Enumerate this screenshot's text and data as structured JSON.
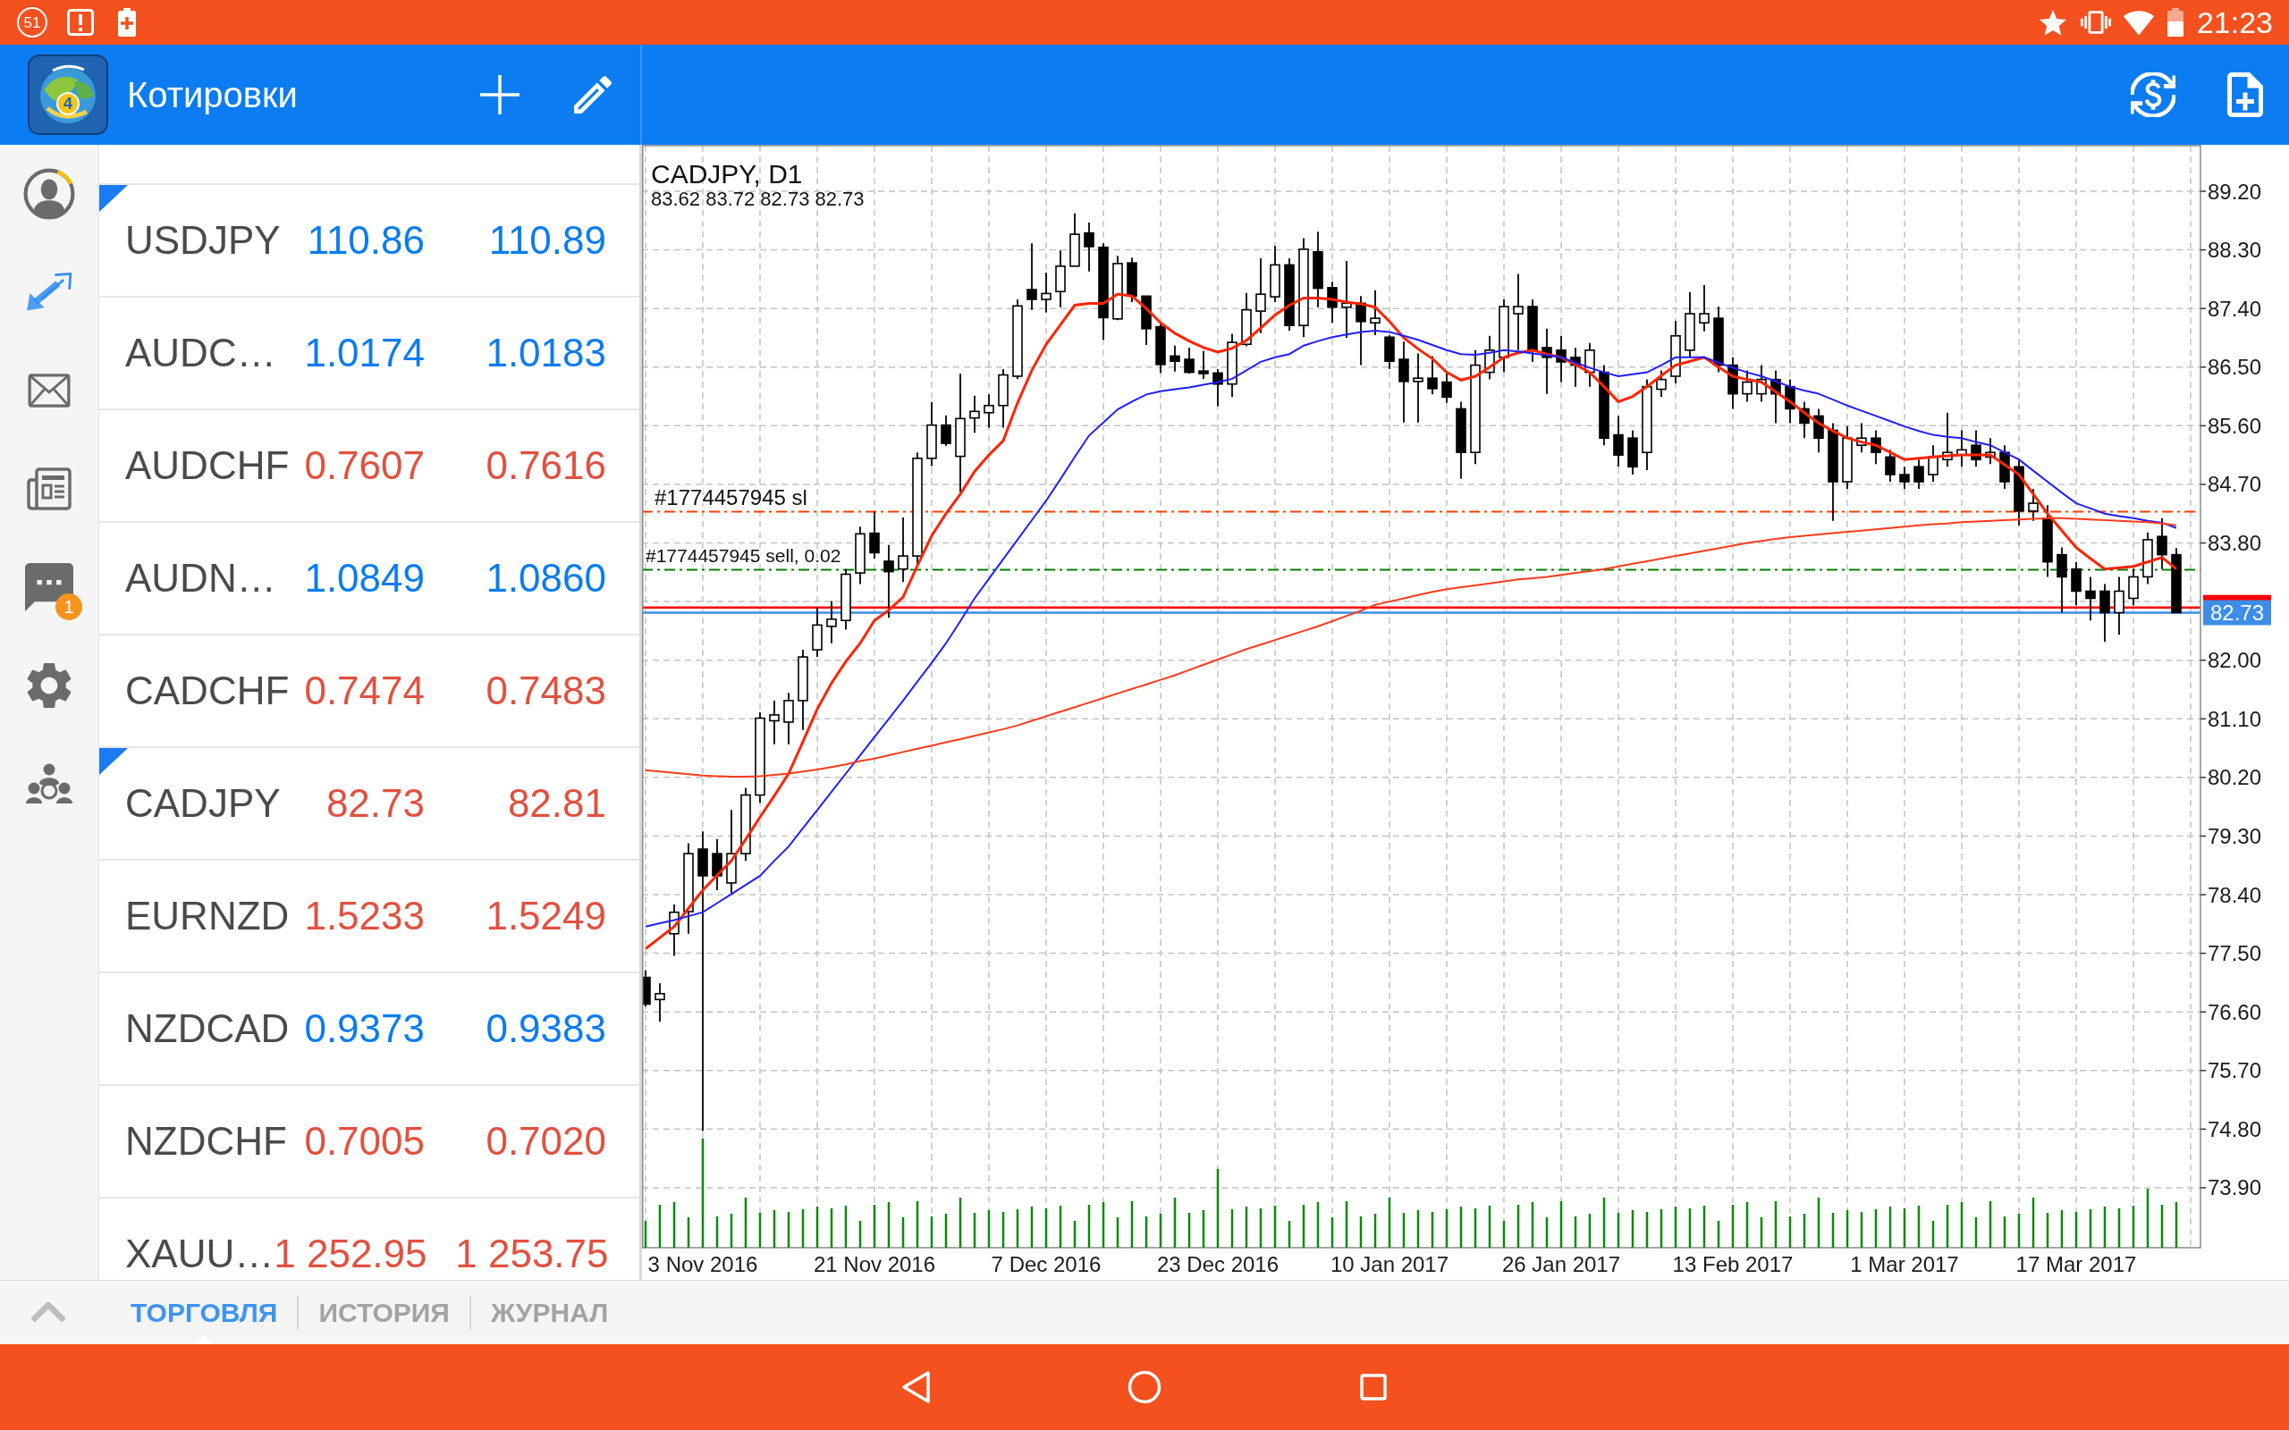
{
  "status_bar": {
    "notification_count": "51",
    "time": "21:23"
  },
  "app_bar": {
    "logo_badge": "4",
    "title": "Котировки"
  },
  "sidebar": {
    "items": [
      {
        "selected": false
      },
      {
        "selected": true
      },
      {
        "selected": false
      },
      {
        "selected": false
      },
      {
        "selected": false,
        "badge": "1"
      },
      {
        "selected": false
      },
      {
        "selected": false
      }
    ]
  },
  "quotes": {
    "rows": [
      {
        "symbol": "USDJPY",
        "bid": "110.86",
        "ask": "110.89",
        "price_up": true,
        "marked": true
      },
      {
        "symbol": "AUDC…",
        "bid": "1.0174",
        "ask": "1.0183",
        "price_up": true,
        "marked": false
      },
      {
        "symbol": "AUDCHF",
        "bid": "0.7607",
        "ask": "0.7616",
        "price_up": false,
        "marked": false
      },
      {
        "symbol": "AUDN…",
        "bid": "1.0849",
        "ask": "1.0860",
        "price_up": true,
        "marked": false
      },
      {
        "symbol": "CADCHF",
        "bid": "0.7474",
        "ask": "0.7483",
        "price_up": false,
        "marked": false
      },
      {
        "symbol": "CADJPY",
        "bid": "82.73",
        "ask": "82.81",
        "price_up": false,
        "marked": true
      },
      {
        "symbol": "EURNZD",
        "bid": "1.5233",
        "ask": "1.5249",
        "price_up": false,
        "marked": false
      },
      {
        "symbol": "NZDCAD",
        "bid": "0.9373",
        "ask": "0.9383",
        "price_up": true,
        "marked": false
      },
      {
        "symbol": "NZDCHF",
        "bid": "0.7005",
        "ask": "0.7020",
        "price_up": false,
        "marked": false
      },
      {
        "symbol": "XAUU…",
        "bid": "1 252.95",
        "ask": "1 253.75",
        "price_up": false,
        "marked": false
      }
    ]
  },
  "chart": {
    "chart_data": [
      {
        "type": "candlestick",
        "title": "CADJPY, D1",
        "subtitle": "83.62 83.72 82.73 82.73",
        "grid": true,
        "categories": [
          null,
          null,
          null,
          null,
          "3 Nov 2016",
          null,
          null,
          null,
          null,
          null,
          null,
          null,
          null,
          null,
          null,
          null,
          "21 Nov 2016",
          null,
          null,
          null,
          null,
          null,
          null,
          null,
          null,
          null,
          null,
          null,
          "7 Dec 2016",
          null,
          null,
          null,
          null,
          null,
          null,
          null,
          null,
          null,
          null,
          null,
          "23 Dec 2016",
          null,
          null,
          null,
          null,
          null,
          null,
          null,
          null,
          null,
          null,
          null,
          "10 Jan 2017",
          null,
          null,
          null,
          null,
          null,
          null,
          null,
          null,
          null,
          null,
          null,
          "26 Jan 2017",
          null,
          null,
          null,
          null,
          null,
          null,
          null,
          null,
          null,
          null,
          null,
          "13 Feb 2017",
          null,
          null,
          null,
          null,
          null,
          null,
          null,
          null,
          null,
          null,
          null,
          "1 Mar 2017",
          null,
          null,
          null,
          null,
          null,
          null,
          null,
          null,
          null,
          null,
          null,
          "17 Mar 2017",
          null,
          null,
          null,
          null,
          null,
          null,
          null
        ],
        "ohlc": [
          [
            77.13,
            77.24,
            76.68,
            76.72
          ],
          [
            76.79,
            77.04,
            76.45,
            76.88
          ],
          [
            77.8,
            78.25,
            77.46,
            78.13
          ],
          [
            78.14,
            79.19,
            77.8,
            79.03
          ],
          [
            79.1,
            79.37,
            74.77,
            78.69
          ],
          [
            79.03,
            79.25,
            78.47,
            78.69
          ],
          [
            78.58,
            79.7,
            78.42,
            79.03
          ],
          [
            79.03,
            80.04,
            78.92,
            79.93
          ],
          [
            79.93,
            81.2,
            79.81,
            81.11
          ],
          [
            81.07,
            81.38,
            80.71,
            81.16
          ],
          [
            81.05,
            81.5,
            80.71,
            81.38
          ],
          [
            81.38,
            82.16,
            80.93,
            82.05
          ],
          [
            82.16,
            82.81,
            82.05,
            82.54
          ],
          [
            82.52,
            82.91,
            82.26,
            82.63
          ],
          [
            82.61,
            83.4,
            82.47,
            83.32
          ],
          [
            83.34,
            84.05,
            83.17,
            83.94
          ],
          [
            83.95,
            84.28,
            83.56,
            83.65
          ],
          [
            83.52,
            83.77,
            82.65,
            83.36
          ],
          [
            83.4,
            84.19,
            83.2,
            83.6
          ],
          [
            83.6,
            85.19,
            83.48,
            85.1
          ],
          [
            85.1,
            85.96,
            84.98,
            85.61
          ],
          [
            85.61,
            85.76,
            85.29,
            85.33
          ],
          [
            85.13,
            86.4,
            84.58,
            85.71
          ],
          [
            85.72,
            86.06,
            85.49,
            85.82
          ],
          [
            85.8,
            86.08,
            85.57,
            85.91
          ],
          [
            85.91,
            86.47,
            85.57,
            86.38
          ],
          [
            86.36,
            87.54,
            86.32,
            87.44
          ],
          [
            87.69,
            88.4,
            87.38,
            87.54
          ],
          [
            87.54,
            87.95,
            87.34,
            87.63
          ],
          [
            87.66,
            88.29,
            87.42,
            88.05
          ],
          [
            88.05,
            88.86,
            88.05,
            88.54
          ],
          [
            88.56,
            88.72,
            87.97,
            88.35
          ],
          [
            88.34,
            88.4,
            86.92,
            87.26
          ],
          [
            87.24,
            88.21,
            87.22,
            88.09
          ],
          [
            88.1,
            88.18,
            87.5,
            87.59
          ],
          [
            87.59,
            87.59,
            86.84,
            87.09
          ],
          [
            87.12,
            87.18,
            86.41,
            86.54
          ],
          [
            86.67,
            86.83,
            86.43,
            86.59
          ],
          [
            86.62,
            86.8,
            86.4,
            86.42
          ],
          [
            86.44,
            86.75,
            86.32,
            86.4
          ],
          [
            86.41,
            86.47,
            85.9,
            86.24
          ],
          [
            86.24,
            87.01,
            86.04,
            86.88
          ],
          [
            86.85,
            87.64,
            86.82,
            87.38
          ],
          [
            87.36,
            88.17,
            87.02,
            87.62
          ],
          [
            87.58,
            88.36,
            87.5,
            88.07
          ],
          [
            88.07,
            88.17,
            87.06,
            87.14
          ],
          [
            87.14,
            88.48,
            86.96,
            88.31
          ],
          [
            88.27,
            88.58,
            87.42,
            87.71
          ],
          [
            87.72,
            87.81,
            87.18,
            87.42
          ],
          [
            87.42,
            88.13,
            86.95,
            87.48
          ],
          [
            87.48,
            87.59,
            86.53,
            87.2
          ],
          [
            87.18,
            87.68,
            86.99,
            87.25
          ],
          [
            86.96,
            86.99,
            86.47,
            86.59
          ],
          [
            86.62,
            86.89,
            85.65,
            86.28
          ],
          [
            86.28,
            86.71,
            85.65,
            86.33
          ],
          [
            86.33,
            86.67,
            86.08,
            86.17
          ],
          [
            86.27,
            86.4,
            85.95,
            86.04
          ],
          [
            85.86,
            85.97,
            84.79,
            85.19
          ],
          [
            85.19,
            86.76,
            85.01,
            86.53
          ],
          [
            86.42,
            86.98,
            86.31,
            86.76
          ],
          [
            86.65,
            87.54,
            86.42,
            87.43
          ],
          [
            87.32,
            87.93,
            86.76,
            87.43
          ],
          [
            87.43,
            87.54,
            86.58,
            86.76
          ],
          [
            86.8,
            87.09,
            86.09,
            86.65
          ],
          [
            86.76,
            86.98,
            86.27,
            86.58
          ],
          [
            86.65,
            86.8,
            86.2,
            86.53
          ],
          [
            86.42,
            86.87,
            86.2,
            86.76
          ],
          [
            86.42,
            86.53,
            85.3,
            85.41
          ],
          [
            85.46,
            85.75,
            84.97,
            85.15
          ],
          [
            85.41,
            85.53,
            84.85,
            84.97
          ],
          [
            85.19,
            86.31,
            84.92,
            86.2
          ],
          [
            86.16,
            86.45,
            86.04,
            86.31
          ],
          [
            86.36,
            87.21,
            86.25,
            86.98
          ],
          [
            86.76,
            87.65,
            86.65,
            87.32
          ],
          [
            87.18,
            87.76,
            87.05,
            87.32
          ],
          [
            87.25,
            87.43,
            86.42,
            86.53
          ],
          [
            86.53,
            86.65,
            85.86,
            86.09
          ],
          [
            86.09,
            86.45,
            85.97,
            86.27
          ],
          [
            86.09,
            86.53,
            85.97,
            86.31
          ],
          [
            86.31,
            86.45,
            85.64,
            86.09
          ],
          [
            86.2,
            86.31,
            85.64,
            85.86
          ],
          [
            85.86,
            85.97,
            85.41,
            85.64
          ],
          [
            85.75,
            85.86,
            85.19,
            85.41
          ],
          [
            85.53,
            85.64,
            84.14,
            84.74
          ],
          [
            84.74,
            85.59,
            84.63,
            85.41
          ],
          [
            85.3,
            85.64,
            85.19,
            85.41
          ],
          [
            85.41,
            85.53,
            85.01,
            85.19
          ],
          [
            85.12,
            85.23,
            84.74,
            84.85
          ],
          [
            84.85,
            84.97,
            84.63,
            84.74
          ],
          [
            84.97,
            85.08,
            84.63,
            84.74
          ],
          [
            84.85,
            85.3,
            84.74,
            85.12
          ],
          [
            85.08,
            85.8,
            84.97,
            85.19
          ],
          [
            85.15,
            85.53,
            84.97,
            85.23
          ],
          [
            85.3,
            85.53,
            84.97,
            85.08
          ],
          [
            85.12,
            85.41,
            85.01,
            85.19
          ],
          [
            85.19,
            85.3,
            84.63,
            84.74
          ],
          [
            84.97,
            85.08,
            84.07,
            84.29
          ],
          [
            84.29,
            84.63,
            84.14,
            84.41
          ],
          [
            84.18,
            84.38,
            83.28,
            83.51
          ],
          [
            83.62,
            83.73,
            82.73,
            83.28
          ],
          [
            83.4,
            83.51,
            82.84,
            83.06
          ],
          [
            83.06,
            83.28,
            82.61,
            82.95
          ],
          [
            83.06,
            83.17,
            82.28,
            82.73
          ],
          [
            82.73,
            83.28,
            82.39,
            83.06
          ],
          [
            82.95,
            83.4,
            82.84,
            83.28
          ],
          [
            83.28,
            83.96,
            83.17,
            83.85
          ],
          [
            83.9,
            84.18,
            83.4,
            83.62
          ],
          [
            83.62,
            83.72,
            82.73,
            82.73
          ]
        ],
        "series": [
          {
            "type": "line",
            "color": "#ff2400",
            "values": [
              77.57,
              77.74,
              77.91,
              78.19,
              78.47,
              78.7,
              78.92,
              79.25,
              79.59,
              79.92,
              80.26,
              80.75,
              81.25,
              81.65,
              81.98,
              82.26,
              82.61,
              82.77,
              82.97,
              83.45,
              83.91,
              84.25,
              84.55,
              84.9,
              85.15,
              85.37,
              85.95,
              86.45,
              86.85,
              87.15,
              87.45,
              87.48,
              87.48,
              87.62,
              87.59,
              87.4,
              87.18,
              87.02,
              86.9,
              86.8,
              86.73,
              86.79,
              86.91,
              87.1,
              87.3,
              87.45,
              87.56,
              87.56,
              87.54,
              87.5,
              87.47,
              87.42,
              87.2,
              86.95,
              86.78,
              86.63,
              86.42,
              86.3,
              86.36,
              86.5,
              86.65,
              86.72,
              86.76,
              86.7,
              86.65,
              86.54,
              86.42,
              86.2,
              85.97,
              86.05,
              86.2,
              86.37,
              86.53,
              86.59,
              86.65,
              86.5,
              86.36,
              86.31,
              86.27,
              86.12,
              85.97,
              85.8,
              85.64,
              85.52,
              85.41,
              85.35,
              85.3,
              85.19,
              85.08,
              85.1,
              85.12,
              85.14,
              85.15,
              85.15,
              85.15,
              85.0,
              84.85,
              84.55,
              84.25,
              83.99,
              83.73,
              83.56,
              83.4,
              83.42,
              83.44,
              83.51,
              83.58,
              83.4
            ]
          },
          {
            "type": "line",
            "color": "#1e1eff",
            "values": [
              77.91,
              77.96,
              78.01,
              78.07,
              78.13,
              78.27,
              78.41,
              78.55,
              78.69,
              78.92,
              79.14,
              79.42,
              79.7,
              79.98,
              80.26,
              80.54,
              80.82,
              81.1,
              81.38,
              81.67,
              81.96,
              82.26,
              82.6,
              82.95,
              83.25,
              83.55,
              83.85,
              84.15,
              84.45,
              84.78,
              85.12,
              85.45,
              85.65,
              85.85,
              85.97,
              86.08,
              86.13,
              86.16,
              86.19,
              86.23,
              86.27,
              86.32,
              86.45,
              86.58,
              86.65,
              86.7,
              86.83,
              86.9,
              86.96,
              87.0,
              87.04,
              87.06,
              87.04,
              86.98,
              86.92,
              86.84,
              86.76,
              86.7,
              86.69,
              86.72,
              86.76,
              86.74,
              86.71,
              86.68,
              86.65,
              86.57,
              86.49,
              86.42,
              86.36,
              86.39,
              86.42,
              86.53,
              86.65,
              86.65,
              86.65,
              86.57,
              86.49,
              86.42,
              86.36,
              86.28,
              86.2,
              86.14,
              86.09,
              86.0,
              85.91,
              85.83,
              85.75,
              85.67,
              85.59,
              85.52,
              85.46,
              85.43,
              85.41,
              85.35,
              85.3,
              85.19,
              85.08,
              84.91,
              84.74,
              84.57,
              84.41,
              84.33,
              84.25,
              84.21,
              84.18,
              84.14,
              84.11,
              84.03
            ]
          },
          {
            "type": "line",
            "color": "#ff3b1a",
            "values": [
              80.31,
              80.29,
              80.27,
              80.25,
              80.23,
              80.22,
              80.21,
              80.21,
              80.22,
              80.24,
              80.26,
              80.29,
              80.32,
              80.36,
              80.4,
              80.45,
              80.49,
              80.54,
              80.59,
              80.64,
              80.69,
              80.74,
              80.79,
              80.84,
              80.89,
              80.94,
              81.0,
              81.07,
              81.14,
              81.21,
              81.28,
              81.35,
              81.42,
              81.49,
              81.56,
              81.63,
              81.7,
              81.77,
              81.85,
              81.93,
              82.01,
              82.09,
              82.17,
              82.24,
              82.31,
              82.38,
              82.45,
              82.52,
              82.6,
              82.68,
              82.76,
              82.85,
              82.9,
              82.95,
              83.0,
              83.05,
              83.09,
              83.12,
              83.15,
              83.18,
              83.21,
              83.24,
              83.26,
              83.28,
              83.31,
              83.34,
              83.37,
              83.4,
              83.44,
              83.48,
              83.52,
              83.56,
              83.6,
              83.64,
              83.68,
              83.72,
              83.76,
              83.8,
              83.83,
              83.86,
              83.89,
              83.91,
              83.93,
              83.95,
              83.97,
              83.99,
              84.01,
              84.03,
              84.05,
              84.07,
              84.09,
              84.1,
              84.12,
              84.13,
              84.14,
              84.15,
              84.16,
              84.17,
              84.18,
              84.18,
              84.17,
              84.16,
              84.15,
              84.14,
              84.13,
              84.12,
              84.1,
              84.07
            ]
          }
        ],
        "ylim": [
          72.98,
          89.9
        ],
        "yticks": [
          {
            "value": 73.9,
            "label": "73.90"
          },
          {
            "value": 74.8,
            "label": "74.80"
          },
          {
            "value": 75.7,
            "label": "75.70"
          },
          {
            "value": 76.6,
            "label": "76.60"
          },
          {
            "value": 77.5,
            "label": "77.50"
          },
          {
            "value": 78.4,
            "label": "78.40"
          },
          {
            "value": 79.3,
            "label": "79.30"
          },
          {
            "value": 80.2,
            "label": "80.20"
          },
          {
            "value": 81.1,
            "label": "81.10"
          },
          {
            "value": 82.0,
            "label": "82.00"
          },
          {
            "value": 83.8,
            "label": "83.80"
          },
          {
            "value": 84.7,
            "label": "84.70"
          },
          {
            "value": 85.6,
            "label": "85.60"
          },
          {
            "value": 86.5,
            "label": "86.50"
          },
          {
            "value": 87.4,
            "label": "87.40"
          },
          {
            "value": 88.3,
            "label": "88.30"
          },
          {
            "value": 89.2,
            "label": "89.20"
          }
        ],
        "ref_lines": [
          {
            "axis": "y",
            "value": 84.28,
            "label": "#1774457945 sl",
            "color": "#ff4000",
            "line_style": "dashdot"
          },
          {
            "axis": "y",
            "value": 83.39,
            "label": "#1774457945 sell, 0.02",
            "color": "#008000",
            "line_style": "dashdot"
          },
          {
            "axis": "y",
            "value": 82.81,
            "color": "#ff0000",
            "line_style": "solid"
          },
          {
            "axis": "y",
            "value": 82.73,
            "label": "82.73",
            "color": "#3c8ee8",
            "line_style": "solid"
          }
        ]
      }
    ]
  },
  "bottom_tabs": [
    {
      "label": "ТОРГОВЛЯ",
      "selected": true
    },
    {
      "label": "ИСТОРИЯ",
      "selected": false
    },
    {
      "label": "ЖУРНАЛ",
      "selected": false
    }
  ]
}
